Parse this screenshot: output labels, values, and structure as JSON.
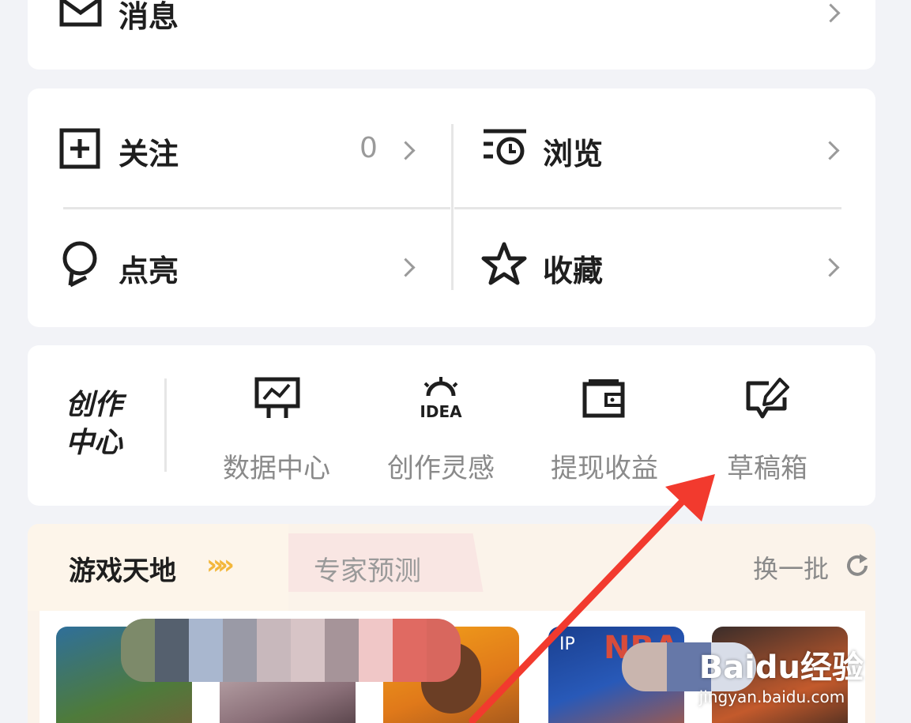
{
  "messages_row": {
    "label": "消息"
  },
  "quick_links": {
    "follow": {
      "label": "关注",
      "count": "0"
    },
    "browse": {
      "label": "浏览"
    },
    "light": {
      "label": "点亮"
    },
    "favorites": {
      "label": "收藏"
    }
  },
  "creation_center": {
    "title_line1": "创作",
    "title_line2": "中心",
    "items": [
      {
        "label": "数据中心",
        "icon": "chart-board-icon"
      },
      {
        "label": "创作灵感",
        "icon": "idea-icon",
        "icon_text": "IDEA"
      },
      {
        "label": "提现收益",
        "icon": "wallet-icon"
      },
      {
        "label": "草稿箱",
        "icon": "draft-edit-icon"
      }
    ]
  },
  "game_section": {
    "tab_active": "游戏天地",
    "tab_inactive": "专家预测",
    "refresh_label": "换一批",
    "card_texts": {
      "nba_badge": "IP",
      "nba_logo": "NBA"
    }
  },
  "watermark": {
    "brand": "Baidu经验",
    "url": "jingyan.baidu.com"
  },
  "colors": {
    "accent_arrow": "#f23a2e",
    "chevron": "#9a9a9a",
    "secondary_text": "#8a8a8a"
  }
}
